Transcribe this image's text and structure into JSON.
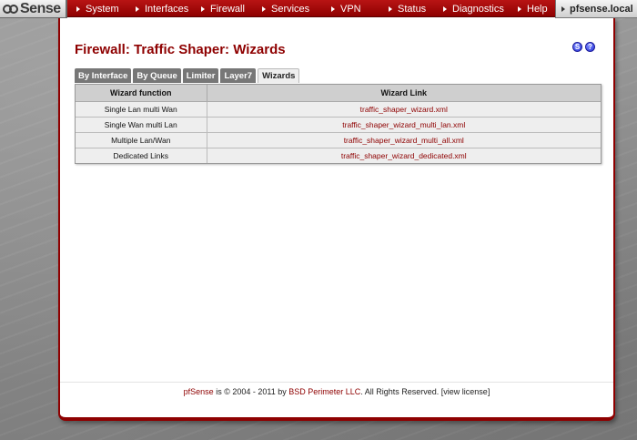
{
  "logo": {
    "text": "Sense"
  },
  "nav": {
    "items": [
      "System",
      "Interfaces",
      "Firewall",
      "Services",
      "VPN",
      "Status",
      "Diagnostics",
      "Help"
    ],
    "hostname": "pfsense.local"
  },
  "page": {
    "title": "Firewall: Traffic Shaper: Wizards"
  },
  "help_icons": {
    "s": "S",
    "q": "?"
  },
  "tabs": [
    {
      "label": "By Interface",
      "active": false
    },
    {
      "label": "By Queue",
      "active": false
    },
    {
      "label": "Limiter",
      "active": false
    },
    {
      "label": "Layer7",
      "active": false
    },
    {
      "label": "Wizards",
      "active": true
    }
  ],
  "table": {
    "headers": [
      "Wizard function",
      "Wizard Link"
    ],
    "rows": [
      [
        "Single Lan multi Wan",
        "traffic_shaper_wizard.xml"
      ],
      [
        "Single Wan multi Lan",
        "traffic_shaper_wizard_multi_lan.xml"
      ],
      [
        "Multiple Lan/Wan",
        "traffic_shaper_wizard_multi_all.xml"
      ],
      [
        "Dedicated Links",
        "traffic_shaper_wizard_dedicated.xml"
      ]
    ]
  },
  "footer": {
    "brand": "pfSense",
    "text1": " is © 2004 - 2011 by ",
    "company": "BSD Perimeter LLC",
    "text2": ". All Rights Reserved. [",
    "license": "view license",
    "text3": "]"
  },
  "colors": {
    "accent": "#8e0000",
    "nav_bar": "#b81414",
    "tab_inactive": "#777777",
    "table_header": "#cfcfcf",
    "icon_blue": "#2232d8"
  }
}
